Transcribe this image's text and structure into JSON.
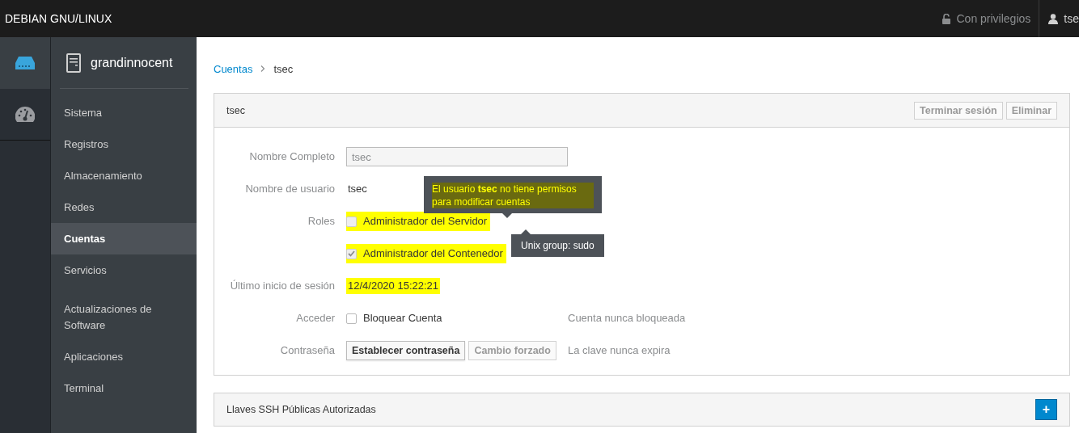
{
  "topbar": {
    "brand": "DEBIAN GNU/LINUX",
    "privileges": "Con privilegios",
    "user": "tse"
  },
  "rail": [
    {
      "kind": "server",
      "selected": true
    },
    {
      "kind": "dashboard",
      "selected": false
    }
  ],
  "host": "grandinnocent",
  "nav_sections": [
    {
      "items": [
        {
          "label": "Sistema",
          "selected": false
        },
        {
          "label": "Registros",
          "selected": false
        },
        {
          "label": "Almacenamiento",
          "selected": false
        },
        {
          "label": "Redes",
          "selected": false
        },
        {
          "label": "Cuentas",
          "selected": true
        },
        {
          "label": "Servicios",
          "selected": false
        }
      ]
    },
    {
      "items": [
        {
          "label": "Actualizaciones de Software",
          "selected": false
        },
        {
          "label": "Aplicaciones",
          "selected": false
        },
        {
          "label": "Terminal",
          "selected": false
        }
      ]
    }
  ],
  "breadcrumb": [
    {
      "label": "Cuentas",
      "link": true
    },
    {
      "label": "tsec",
      "link": false
    }
  ],
  "account_panel": {
    "title": "tsec",
    "actions": [
      {
        "label": "Terminar sesión",
        "disabled": true
      },
      {
        "label": "Eliminar",
        "disabled": true
      }
    ],
    "rows": [
      {
        "kind": "input",
        "label": "Nombre Completo",
        "value": "tsec",
        "disabled": true
      },
      {
        "kind": "text",
        "label": "Nombre de usuario",
        "value": "tsec",
        "highlighted": false
      },
      {
        "kind": "checks",
        "label": "Roles",
        "options": [
          {
            "label": "Administrador del Servidor",
            "checked": false,
            "disabled": true,
            "highlighted": true
          },
          {
            "label": "Administrador del Contenedor",
            "checked": true,
            "disabled": true,
            "highlighted": true
          }
        ],
        "tooltips": [
          {
            "text": "El usuario **tsec** no tiene permisos para modificar cuentas",
            "highlighted": true
          },
          {
            "text": "Unix group: sudo",
            "highlighted": false
          }
        ]
      },
      {
        "kind": "text",
        "label": "Último inicio de sesión",
        "value": "12/4/2020 15:22:21",
        "highlighted": true
      },
      {
        "kind": "checks",
        "label": "Acceder",
        "options": [
          {
            "label": "Bloquear Cuenta",
            "checked": false,
            "disabled": false,
            "highlighted": false
          }
        ],
        "note": "Cuenta nunca bloqueada"
      },
      {
        "kind": "buttons",
        "label": "Contraseña",
        "buttons": [
          {
            "label": "Establecer contraseña",
            "disabled": false
          },
          {
            "label": "Cambio forzado",
            "disabled": true
          }
        ],
        "note": "La clave nunca expira"
      }
    ]
  },
  "ssh_panel": {
    "title": "Llaves SSH Públicas Autorizadas",
    "add_button": "+"
  }
}
